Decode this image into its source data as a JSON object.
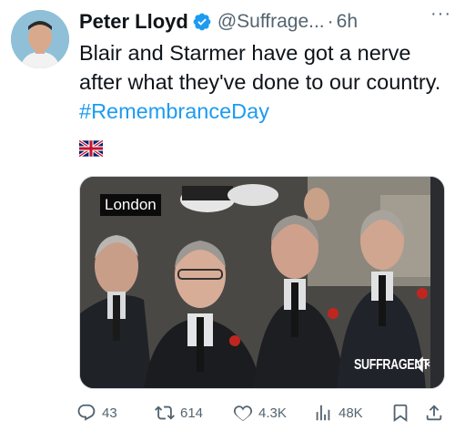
{
  "tweet": {
    "author_name": "Peter Lloyd",
    "handle": "@Suffrage...",
    "separator": "·",
    "time": "6h",
    "more": "···",
    "text_before": "Blair and Starmer have got a nerve after what they've done to our country. ",
    "hashtag": "#RemembranceDay",
    "flag_icon": "uk-flag-icon"
  },
  "media": {
    "location_label": "London",
    "watermark": "SUFFRAGENT",
    "mute_icon": "speaker-muted-icon"
  },
  "actions": {
    "replies": "43",
    "reposts": "614",
    "likes": "4.3K",
    "views": "48K"
  },
  "colors": {
    "accent": "#1d9bf0",
    "muted_text": "#536471",
    "text": "#0f1419"
  }
}
